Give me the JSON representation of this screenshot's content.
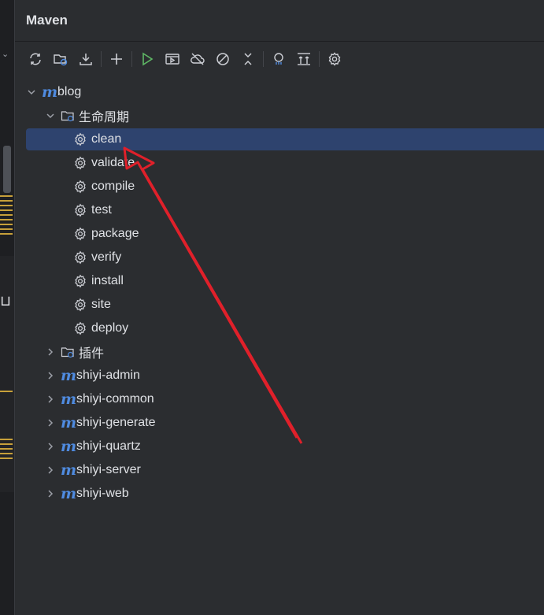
{
  "panel": {
    "title": "Maven"
  },
  "toolbar": {
    "buttons": [
      {
        "name": "reload-icon"
      },
      {
        "name": "generate-sources-icon"
      },
      {
        "name": "download-icon"
      },
      {
        "name": "add-icon"
      },
      {
        "name": "run-icon"
      },
      {
        "name": "run-config-icon"
      },
      {
        "name": "offline-icon"
      },
      {
        "name": "skip-tests-icon"
      },
      {
        "name": "collapse-icon"
      },
      {
        "name": "dependency-analyzer-icon"
      },
      {
        "name": "show-dependencies-icon"
      },
      {
        "name": "settings-icon"
      }
    ]
  },
  "tree": {
    "root": {
      "label": "blog",
      "expanded": true
    },
    "lifecycle": {
      "label": "生命周期",
      "expanded": true
    },
    "phases": [
      "clean",
      "validate",
      "compile",
      "test",
      "package",
      "verify",
      "install",
      "site",
      "deploy"
    ],
    "selected_phase": "clean",
    "plugins": {
      "label": "插件",
      "expanded": false
    },
    "modules": [
      "shiyi-admin",
      "shiyi-common",
      "shiyi-generate",
      "shiyi-quartz",
      "shiyi-server",
      "shiyi-web"
    ]
  },
  "colors": {
    "accent": "#4f8be0",
    "selection": "#2e436e",
    "annotation": "#e0202a",
    "run": "#5fb865"
  }
}
